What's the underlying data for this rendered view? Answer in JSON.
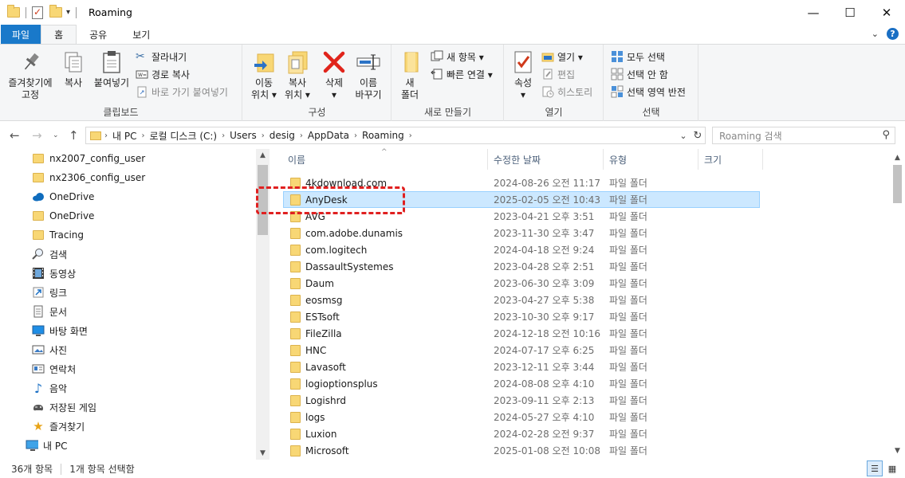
{
  "window": {
    "title": "Roaming",
    "minimize": "—",
    "maximize": "☐",
    "close": "✕"
  },
  "ribbon_tabs": [
    "파일",
    "홈",
    "공유",
    "보기"
  ],
  "ribbon": {
    "clipboard": {
      "label": "클립보드",
      "pin": [
        "즐겨찾기에",
        "고정"
      ],
      "copy": "복사",
      "paste": "붙여넣기",
      "cut": "잘라내기",
      "copy_path": "경로 복사",
      "paste_shortcut": "바로 가기 붙여넣기"
    },
    "organize": {
      "label": "구성",
      "move_to": [
        "이동",
        "위치 ▾"
      ],
      "copy_to": [
        "복사",
        "위치 ▾"
      ],
      "delete": [
        "삭제",
        "▾"
      ],
      "rename": [
        "이름",
        "바꾸기"
      ]
    },
    "new": {
      "label": "새로 만들기",
      "new_folder": [
        "새",
        "폴더"
      ],
      "new_item": "새 항목 ▾",
      "easy_access": "빠른 연결 ▾"
    },
    "open": {
      "label": "열기",
      "properties": [
        "속성",
        "▾"
      ],
      "open": "열기 ▾",
      "edit": "편집",
      "history": "히스토리"
    },
    "select": {
      "label": "선택",
      "select_all": "모두 선택",
      "select_none": "선택 안 함",
      "invert": "선택 영역 반전"
    }
  },
  "address": {
    "crumbs": [
      "내 PC",
      "로컬 디스크 (C:)",
      "Users",
      "desig",
      "AppData",
      "Roaming"
    ],
    "search_placeholder": "Roaming 검색"
  },
  "nav_pane": [
    {
      "label": "nx2007_config_user",
      "icon": "folder-icon"
    },
    {
      "label": "nx2306_config_user",
      "icon": "folder-icon"
    },
    {
      "label": "OneDrive",
      "icon": "cloud-icon"
    },
    {
      "label": "OneDrive",
      "icon": "folder-icon"
    },
    {
      "label": "Tracing",
      "icon": "folder-icon"
    },
    {
      "label": "검색",
      "icon": "search-icon"
    },
    {
      "label": "동영상",
      "icon": "video-icon"
    },
    {
      "label": "링크",
      "icon": "link-icon"
    },
    {
      "label": "문서",
      "icon": "document-icon"
    },
    {
      "label": "바탕 화면",
      "icon": "desktop-icon"
    },
    {
      "label": "사진",
      "icon": "picture-icon"
    },
    {
      "label": "연락처",
      "icon": "contacts-icon"
    },
    {
      "label": "음악",
      "icon": "music-icon"
    },
    {
      "label": "저장된 게임",
      "icon": "games-icon"
    },
    {
      "label": "즐겨찾기",
      "icon": "star-icon"
    },
    {
      "label": "내 PC",
      "icon": "pc-icon"
    }
  ],
  "columns": [
    "이름",
    "수정한 날짜",
    "유형",
    "크기"
  ],
  "files": [
    {
      "name": "4kdownload.com",
      "date": "2024-08-26 오전 11:17",
      "type": "파일 폴더",
      "selected": false
    },
    {
      "name": "AnyDesk",
      "date": "2025-02-05 오전 10:43",
      "type": "파일 폴더",
      "selected": true
    },
    {
      "name": "AVG",
      "date": "2023-04-21 오후 3:51",
      "type": "파일 폴더",
      "selected": false
    },
    {
      "name": "com.adobe.dunamis",
      "date": "2023-11-30 오후 3:47",
      "type": "파일 폴더",
      "selected": false
    },
    {
      "name": "com.logitech",
      "date": "2024-04-18 오전 9:24",
      "type": "파일 폴더",
      "selected": false
    },
    {
      "name": "DassaultSystemes",
      "date": "2023-04-28 오후 2:51",
      "type": "파일 폴더",
      "selected": false
    },
    {
      "name": "Daum",
      "date": "2023-06-30 오후 3:09",
      "type": "파일 폴더",
      "selected": false
    },
    {
      "name": "eosmsg",
      "date": "2023-04-27 오후 5:38",
      "type": "파일 폴더",
      "selected": false
    },
    {
      "name": "ESTsoft",
      "date": "2023-10-30 오후 9:17",
      "type": "파일 폴더",
      "selected": false
    },
    {
      "name": "FileZilla",
      "date": "2024-12-18 오전 10:16",
      "type": "파일 폴더",
      "selected": false
    },
    {
      "name": "HNC",
      "date": "2024-07-17 오후 6:25",
      "type": "파일 폴더",
      "selected": false
    },
    {
      "name": "Lavasoft",
      "date": "2023-12-11 오후 3:44",
      "type": "파일 폴더",
      "selected": false
    },
    {
      "name": "logioptionsplus",
      "date": "2024-08-08 오후 4:10",
      "type": "파일 폴더",
      "selected": false
    },
    {
      "name": "Logishrd",
      "date": "2023-09-11 오후 2:13",
      "type": "파일 폴더",
      "selected": false
    },
    {
      "name": "logs",
      "date": "2024-05-27 오후 4:10",
      "type": "파일 폴더",
      "selected": false
    },
    {
      "name": "Luxion",
      "date": "2024-02-28 오전 9:37",
      "type": "파일 폴더",
      "selected": false
    },
    {
      "name": "Microsoft",
      "date": "2025-01-08 오전 10:08",
      "type": "파일 폴더",
      "selected": false
    }
  ],
  "status": {
    "count": "36개 항목",
    "selection": "1개 항목 선택함"
  },
  "colors": {
    "file_tab": "#1979ca",
    "selection_bg": "#cce8ff",
    "highlight_box": "#e02020",
    "folder": "#f8d775"
  }
}
